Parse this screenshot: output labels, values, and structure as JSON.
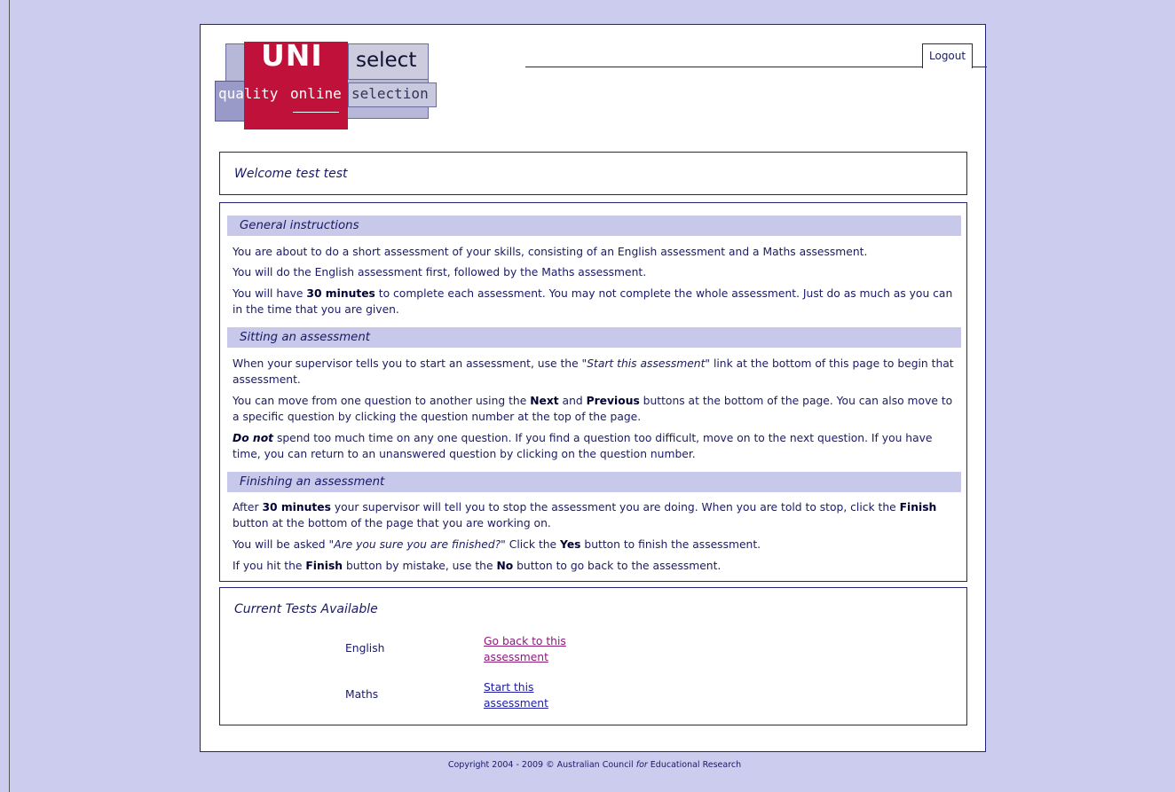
{
  "logo": {
    "word1": "UNI",
    "word2": "select",
    "tag_quality": "quality",
    "tag_online": "online",
    "tag_selection": "selection"
  },
  "header": {
    "logout_label": "Logout"
  },
  "welcome": "Welcome test test",
  "sections": {
    "general": {
      "heading": "General instructions",
      "p1": "You are about to do a short assessment of your skills, consisting of an English assessment and a Maths assessment.",
      "p2": "You will do the English assessment first, followed by the Maths assessment.",
      "p3_a": "You will have ",
      "p3_b": "30 minutes",
      "p3_c": " to complete each assessment. You may not complete the whole assessment. Just do as much as you can in the time that you are given."
    },
    "sitting": {
      "heading": "Sitting an assessment",
      "p1_a": "When your supervisor tells you to start an assessment, use the ",
      "p1_b": "\"Start this assessment\"",
      "p1_c": " link at the bottom of this page to begin that assessment.",
      "p2_a": "You can move from one question to another using the ",
      "p2_b": "Next",
      "p2_c": " and ",
      "p2_d": "Previous",
      "p2_e": " buttons at the bottom of the page. You can also move to a specific question by clicking the question number at the top of the page.",
      "p3_a": "Do not",
      "p3_b": " spend too much time on any one question. If you find a question too difficult, move on to the next question. If you have time, you can return to an unanswered question by clicking on the question number."
    },
    "finishing": {
      "heading": "Finishing an assessment",
      "p1_a": "After ",
      "p1_b": "30 minutes",
      "p1_c": " your supervisor will tell you to stop the assessment you are doing. When you are told to stop, click the ",
      "p1_d": "Finish",
      "p1_e": " button at the bottom of the page that you are working on.",
      "p2_a": "You will be asked ",
      "p2_b": "\"Are you sure you are finished?\"",
      "p2_c": " Click the ",
      "p2_d": "Yes",
      "p2_e": " button to finish the assessment.",
      "p3_a": "If you hit the ",
      "p3_b": "Finish",
      "p3_c": " button by mistake, use the ",
      "p3_d": "No",
      "p3_e": " button to go back to the assessment."
    }
  },
  "tests": {
    "title": "Current Tests Available",
    "items": [
      {
        "name": "English",
        "link_line1": "Go back to this",
        "link_line2": "assessment",
        "visited": true
      },
      {
        "name": "Maths",
        "link_line1": "Start this",
        "link_line2": "assessment",
        "visited": false
      }
    ]
  },
  "footer": {
    "a": "Copyright 2004 - 2009 © Australian Council ",
    "b": "for",
    "c": " Educational Research"
  },
  "colors": {
    "background": "#ccccee",
    "accent_red": "#c0113b",
    "navy": "#1a1a66",
    "section_band": "#c8c8ea",
    "visited_link": "#8b1a7a",
    "link": "#1c1ca8"
  }
}
